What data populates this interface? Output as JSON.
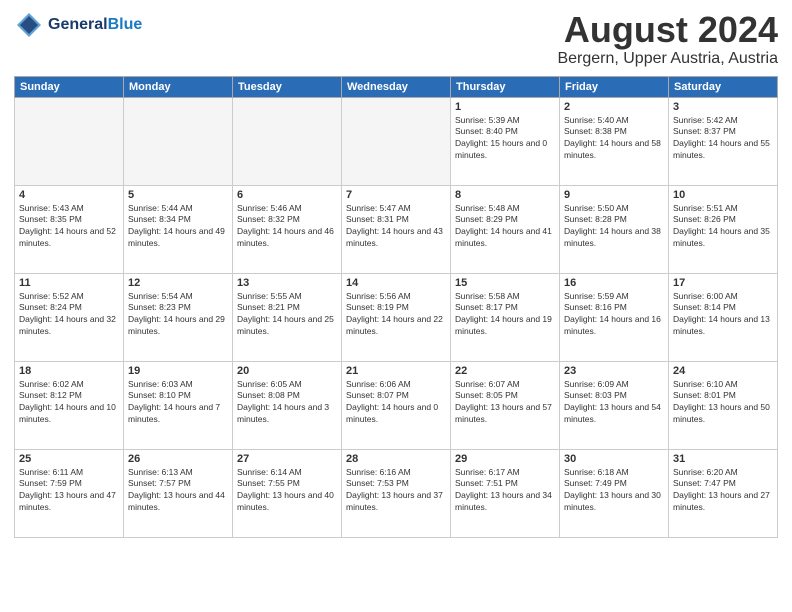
{
  "header": {
    "logo_general": "General",
    "logo_blue": "Blue",
    "month": "August 2024",
    "location": "Bergern, Upper Austria, Austria"
  },
  "weekdays": [
    "Sunday",
    "Monday",
    "Tuesday",
    "Wednesday",
    "Thursday",
    "Friday",
    "Saturday"
  ],
  "weeks": [
    [
      {
        "day": "",
        "empty": true
      },
      {
        "day": "",
        "empty": true
      },
      {
        "day": "",
        "empty": true
      },
      {
        "day": "",
        "empty": true
      },
      {
        "day": "1",
        "sunrise": "Sunrise: 5:39 AM",
        "sunset": "Sunset: 8:40 PM",
        "daylight": "Daylight: 15 hours and 0 minutes."
      },
      {
        "day": "2",
        "sunrise": "Sunrise: 5:40 AM",
        "sunset": "Sunset: 8:38 PM",
        "daylight": "Daylight: 14 hours and 58 minutes."
      },
      {
        "day": "3",
        "sunrise": "Sunrise: 5:42 AM",
        "sunset": "Sunset: 8:37 PM",
        "daylight": "Daylight: 14 hours and 55 minutes."
      }
    ],
    [
      {
        "day": "4",
        "sunrise": "Sunrise: 5:43 AM",
        "sunset": "Sunset: 8:35 PM",
        "daylight": "Daylight: 14 hours and 52 minutes."
      },
      {
        "day": "5",
        "sunrise": "Sunrise: 5:44 AM",
        "sunset": "Sunset: 8:34 PM",
        "daylight": "Daylight: 14 hours and 49 minutes."
      },
      {
        "day": "6",
        "sunrise": "Sunrise: 5:46 AM",
        "sunset": "Sunset: 8:32 PM",
        "daylight": "Daylight: 14 hours and 46 minutes."
      },
      {
        "day": "7",
        "sunrise": "Sunrise: 5:47 AM",
        "sunset": "Sunset: 8:31 PM",
        "daylight": "Daylight: 14 hours and 43 minutes."
      },
      {
        "day": "8",
        "sunrise": "Sunrise: 5:48 AM",
        "sunset": "Sunset: 8:29 PM",
        "daylight": "Daylight: 14 hours and 41 minutes."
      },
      {
        "day": "9",
        "sunrise": "Sunrise: 5:50 AM",
        "sunset": "Sunset: 8:28 PM",
        "daylight": "Daylight: 14 hours and 38 minutes."
      },
      {
        "day": "10",
        "sunrise": "Sunrise: 5:51 AM",
        "sunset": "Sunset: 8:26 PM",
        "daylight": "Daylight: 14 hours and 35 minutes."
      }
    ],
    [
      {
        "day": "11",
        "sunrise": "Sunrise: 5:52 AM",
        "sunset": "Sunset: 8:24 PM",
        "daylight": "Daylight: 14 hours and 32 minutes."
      },
      {
        "day": "12",
        "sunrise": "Sunrise: 5:54 AM",
        "sunset": "Sunset: 8:23 PM",
        "daylight": "Daylight: 14 hours and 29 minutes."
      },
      {
        "day": "13",
        "sunrise": "Sunrise: 5:55 AM",
        "sunset": "Sunset: 8:21 PM",
        "daylight": "Daylight: 14 hours and 25 minutes."
      },
      {
        "day": "14",
        "sunrise": "Sunrise: 5:56 AM",
        "sunset": "Sunset: 8:19 PM",
        "daylight": "Daylight: 14 hours and 22 minutes."
      },
      {
        "day": "15",
        "sunrise": "Sunrise: 5:58 AM",
        "sunset": "Sunset: 8:17 PM",
        "daylight": "Daylight: 14 hours and 19 minutes."
      },
      {
        "day": "16",
        "sunrise": "Sunrise: 5:59 AM",
        "sunset": "Sunset: 8:16 PM",
        "daylight": "Daylight: 14 hours and 16 minutes."
      },
      {
        "day": "17",
        "sunrise": "Sunrise: 6:00 AM",
        "sunset": "Sunset: 8:14 PM",
        "daylight": "Daylight: 14 hours and 13 minutes."
      }
    ],
    [
      {
        "day": "18",
        "sunrise": "Sunrise: 6:02 AM",
        "sunset": "Sunset: 8:12 PM",
        "daylight": "Daylight: 14 hours and 10 minutes."
      },
      {
        "day": "19",
        "sunrise": "Sunrise: 6:03 AM",
        "sunset": "Sunset: 8:10 PM",
        "daylight": "Daylight: 14 hours and 7 minutes."
      },
      {
        "day": "20",
        "sunrise": "Sunrise: 6:05 AM",
        "sunset": "Sunset: 8:08 PM",
        "daylight": "Daylight: 14 hours and 3 minutes."
      },
      {
        "day": "21",
        "sunrise": "Sunrise: 6:06 AM",
        "sunset": "Sunset: 8:07 PM",
        "daylight": "Daylight: 14 hours and 0 minutes."
      },
      {
        "day": "22",
        "sunrise": "Sunrise: 6:07 AM",
        "sunset": "Sunset: 8:05 PM",
        "daylight": "Daylight: 13 hours and 57 minutes."
      },
      {
        "day": "23",
        "sunrise": "Sunrise: 6:09 AM",
        "sunset": "Sunset: 8:03 PM",
        "daylight": "Daylight: 13 hours and 54 minutes."
      },
      {
        "day": "24",
        "sunrise": "Sunrise: 6:10 AM",
        "sunset": "Sunset: 8:01 PM",
        "daylight": "Daylight: 13 hours and 50 minutes."
      }
    ],
    [
      {
        "day": "25",
        "sunrise": "Sunrise: 6:11 AM",
        "sunset": "Sunset: 7:59 PM",
        "daylight": "Daylight: 13 hours and 47 minutes."
      },
      {
        "day": "26",
        "sunrise": "Sunrise: 6:13 AM",
        "sunset": "Sunset: 7:57 PM",
        "daylight": "Daylight: 13 hours and 44 minutes."
      },
      {
        "day": "27",
        "sunrise": "Sunrise: 6:14 AM",
        "sunset": "Sunset: 7:55 PM",
        "daylight": "Daylight: 13 hours and 40 minutes."
      },
      {
        "day": "28",
        "sunrise": "Sunrise: 6:16 AM",
        "sunset": "Sunset: 7:53 PM",
        "daylight": "Daylight: 13 hours and 37 minutes."
      },
      {
        "day": "29",
        "sunrise": "Sunrise: 6:17 AM",
        "sunset": "Sunset: 7:51 PM",
        "daylight": "Daylight: 13 hours and 34 minutes."
      },
      {
        "day": "30",
        "sunrise": "Sunrise: 6:18 AM",
        "sunset": "Sunset: 7:49 PM",
        "daylight": "Daylight: 13 hours and 30 minutes."
      },
      {
        "day": "31",
        "sunrise": "Sunrise: 6:20 AM",
        "sunset": "Sunset: 7:47 PM",
        "daylight": "Daylight: 13 hours and 27 minutes."
      }
    ]
  ]
}
